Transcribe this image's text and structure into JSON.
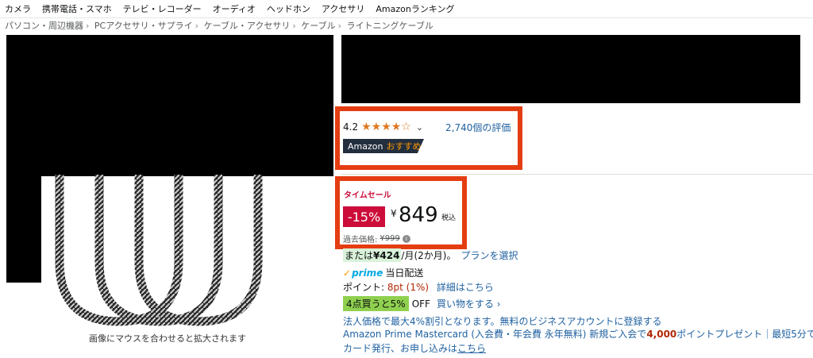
{
  "topnav": [
    "カメラ",
    "携帯電話・スマホ",
    "テレビ・レコーダー",
    "オーディオ",
    "ヘッドホン",
    "アクセサリ",
    "Amazonランキング"
  ],
  "breadcrumb": [
    "パソコン・周辺機器",
    "PCアクセサリ・サプライ",
    "ケーブル・アクセサリ",
    "ケーブル",
    "ライトニングケーブル"
  ],
  "image_panel": {
    "hover_note": "画像にマウスを合わせると拡大されます"
  },
  "rating": {
    "score": "4.2",
    "stars": "★★★★☆",
    "review_count": "2,740個の評価",
    "star_color": "#de7921"
  },
  "badge": {
    "brand": "Amazon",
    "label": "おすすめ"
  },
  "deal": {
    "label": "タイムセール",
    "discount": "-15%",
    "currency": "¥",
    "price": "849",
    "tax_note": "税込",
    "past_price_label": "過去価格:",
    "past_price": "¥999"
  },
  "installment": {
    "prefix": "または",
    "amount": "¥424",
    "suffix": "/月(2か月)。",
    "link": "プランを選択"
  },
  "prime": {
    "logo": "prime",
    "delivery": "当日配送"
  },
  "points": {
    "label": "ポイント:",
    "value": "8pt",
    "percent": "(1%)",
    "link": "詳細はこちら"
  },
  "bulk": {
    "tag": "4点買うと5%",
    "off": "OFF",
    "link": "買い物をする ›"
  },
  "corporate": "法人価格で最大4%割引となります。無料のビジネスアカウントに登録する",
  "card": {
    "line1_a": "Amazon Prime Mastercard (入会費・年会費 永年無料) 新規ご入会で",
    "line1_b": "4,000",
    "line1_c": "ポイントプレゼント｜最短5分で",
    "line2_a": "カード発行、お申し込みは",
    "line2_link": "こちら"
  },
  "colors": {
    "highlight_box": "#e53d12",
    "deal_red": "#cc0c39",
    "link": "#2162a1",
    "bulk_green": "#8fd14f"
  }
}
